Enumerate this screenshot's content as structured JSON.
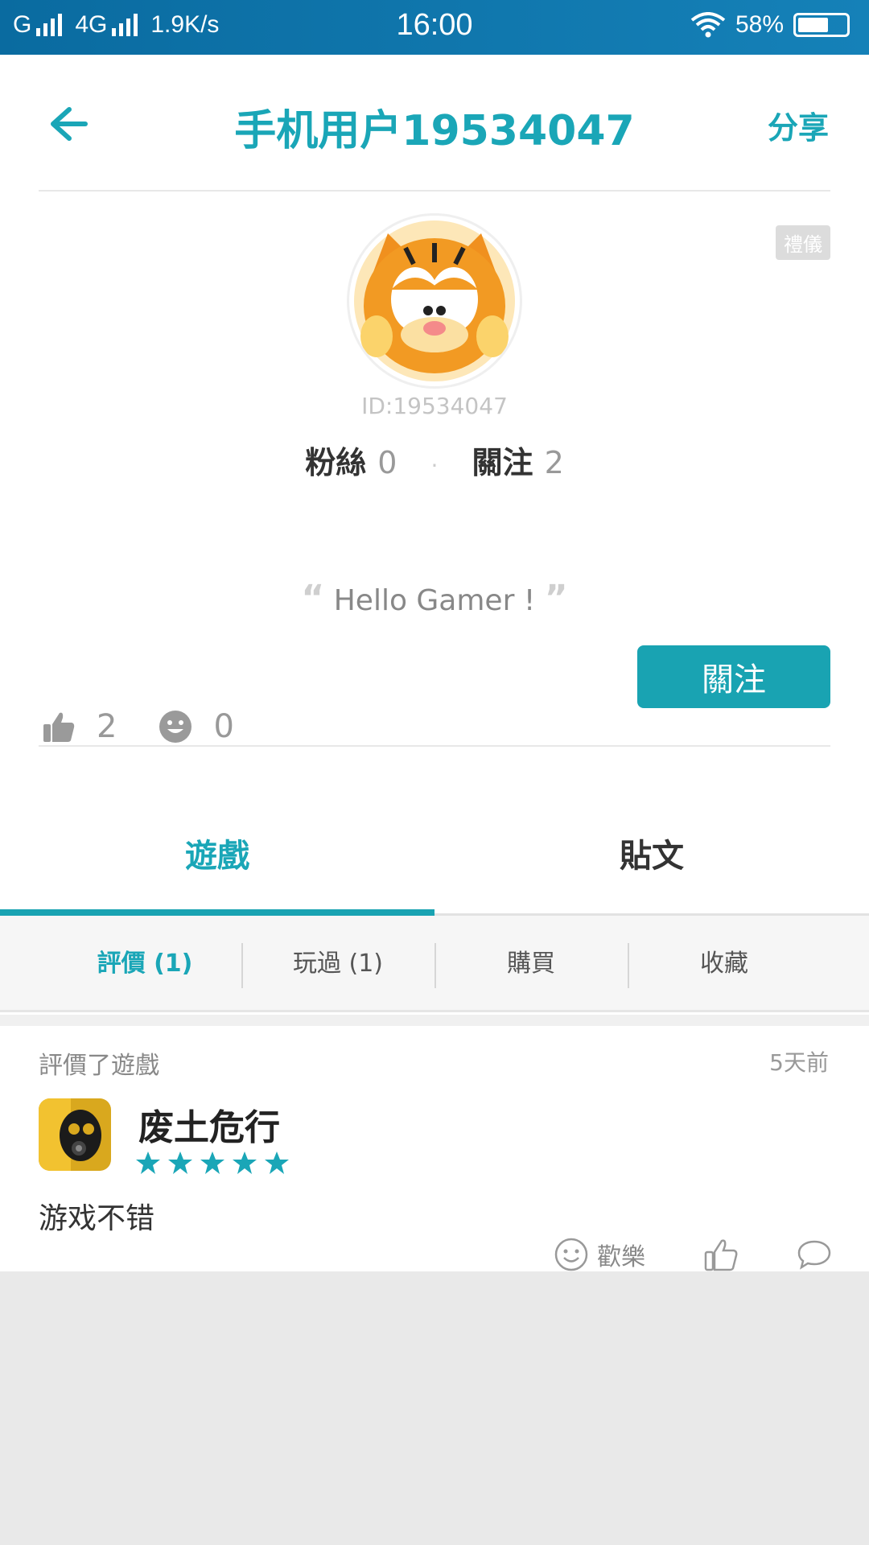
{
  "status_bar": {
    "carrier1": "G",
    "carrier2": "4G",
    "speed": "1.9K/s",
    "time": "16:00",
    "battery": "58%",
    "battery_level": 0.58
  },
  "header": {
    "title": "手机用户19534047",
    "share_label": "分享"
  },
  "profile": {
    "badge": "禮儀",
    "id_text": "ID:19534047",
    "fans_label": "粉絲",
    "fans_count": "0",
    "following_label": "關注",
    "following_count": "2",
    "bio": "Hello Gamer !",
    "likes_count": "2",
    "smiles_count": "0",
    "follow_button": "關注"
  },
  "tabs": [
    {
      "label": "遊戲",
      "active": true
    },
    {
      "label": "貼文",
      "active": false
    }
  ],
  "subtabs": [
    {
      "label": "評價 (1)",
      "active": true
    },
    {
      "label": "玩過 (1)",
      "active": false
    },
    {
      "label": "購買",
      "active": false
    },
    {
      "label": "收藏",
      "active": false
    }
  ],
  "review": {
    "label": "評價了遊戲",
    "time": "5天前",
    "game_name": "废土危行",
    "rating": 5,
    "text": "游戏不错",
    "fun_label": "歡樂"
  },
  "colors": {
    "accent": "#1aa6b7",
    "status_bar": "#0a6ba0",
    "background": "#e9e9e9"
  },
  "icons": [
    "back-arrow-icon",
    "thumb-up-icon",
    "smile-icon",
    "star-icon",
    "comment-icon",
    "wifi-icon",
    "battery-icon"
  ]
}
